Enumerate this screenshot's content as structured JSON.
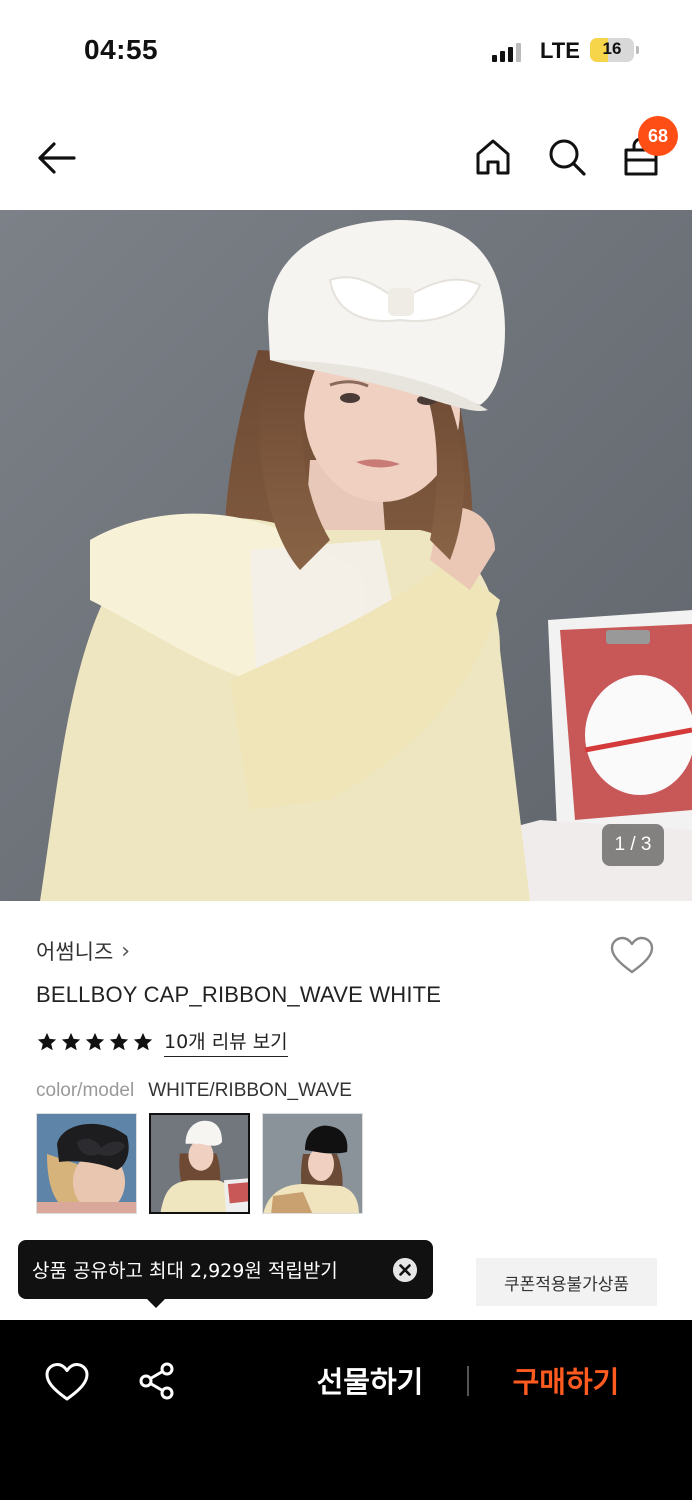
{
  "status_bar": {
    "time": "04:55",
    "network": "LTE",
    "battery": "16",
    "battery_level": 0.16
  },
  "nav": {
    "cart_count": "68",
    "icons": [
      "back-arrow-icon",
      "home-icon",
      "search-icon",
      "shopping-bag-icon"
    ]
  },
  "hero": {
    "image_counter": "1 / 3"
  },
  "product": {
    "brand": "어썸니즈",
    "brand_chevron": "›",
    "name": "BELLBOY CAP_RIBBON_WAVE WHITE",
    "rating": 5,
    "review_link": "10개 리뷰 보기",
    "option_label": "color/model",
    "option_value": "WHITE/RIBBON_WAVE",
    "variants": [
      {
        "label": "black ribbon cap",
        "selected": false
      },
      {
        "label": "white ribbon cap",
        "selected": true
      },
      {
        "label": "black cap",
        "selected": false
      }
    ]
  },
  "tooltip": {
    "text": "상품 공유하고 최대 2,929원 적립받기"
  },
  "coupon_tag": "쿠폰적용불가상품",
  "bottom_bar": {
    "gift_label": "선물하기",
    "buy_label": "구매하기"
  },
  "colors": {
    "accent": "#ff5a1f",
    "badge": "#ff4d16",
    "bottom_bar_bg": "#000000"
  }
}
